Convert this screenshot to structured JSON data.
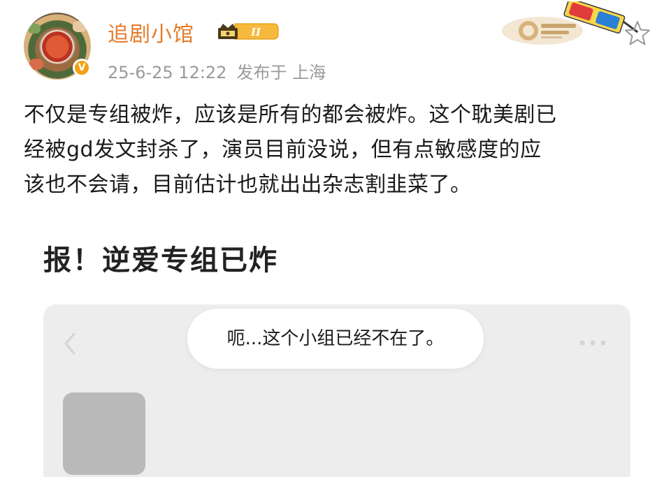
{
  "user": {
    "name": "追剧小馆",
    "member_level": "II",
    "verified_mark": "V"
  },
  "post": {
    "date_time": "25-6-25 12:22",
    "published_from": "发布于 上海",
    "text_lines": [
      "不仅是专组被炸，应该是所有的都会被炸。这个耽美剧已",
      "经被gd发文封杀了，演员目前没说，但有点敏感度的应",
      "该也不会请，目前估计也就出出杂志割韭菜了。"
    ]
  },
  "embedded_image": {
    "title": "报！逆爱专组已炸",
    "toast_message": "呃...这个小组已经不在了。"
  },
  "icons": {
    "star": "star-outline-icon",
    "back": "chevron-left-icon",
    "more": "more-dots-icon",
    "verify": "verified-badge-icon",
    "member": "crown-member-badge-icon"
  },
  "colors": {
    "username": "#e67b2a",
    "meta_text": "#9a9a9a",
    "verify_badge": "#f3a012",
    "member_badge": "#f6b93b",
    "screen_bg": "#ededed",
    "placeholder": "#b9b9b9"
  }
}
